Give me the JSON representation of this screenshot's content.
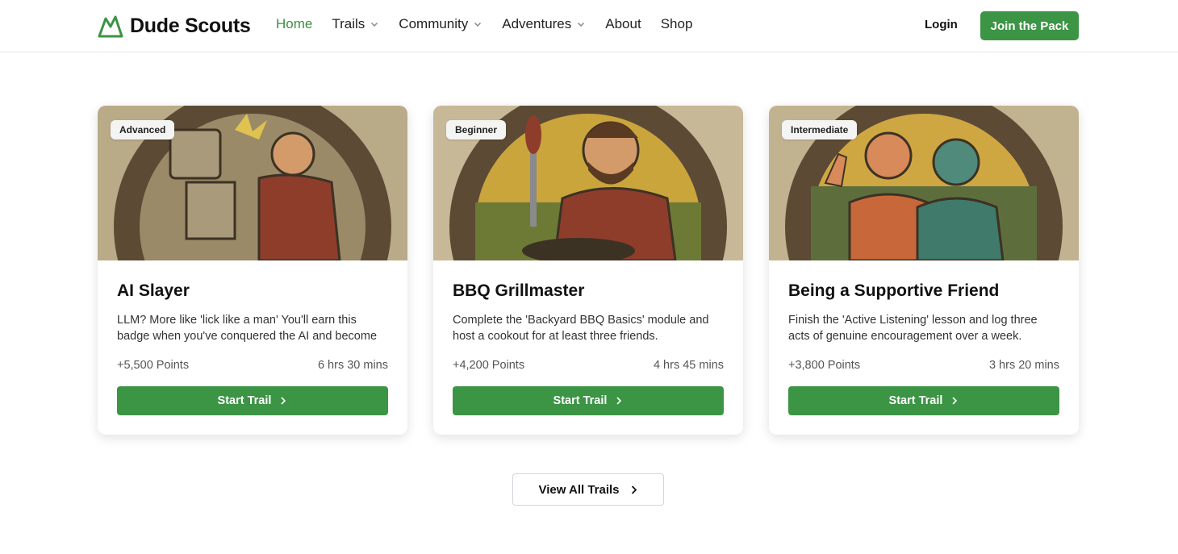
{
  "brand": {
    "name": "Dude Scouts",
    "logo_icon": "mountain-icon",
    "accent": "#3c9445"
  },
  "nav": {
    "items": [
      {
        "label": "Home",
        "active": true,
        "dropdown": false
      },
      {
        "label": "Trails",
        "active": false,
        "dropdown": true
      },
      {
        "label": "Community",
        "active": false,
        "dropdown": true
      },
      {
        "label": "Adventures",
        "active": false,
        "dropdown": true
      },
      {
        "label": "About",
        "active": false,
        "dropdown": false
      },
      {
        "label": "Shop",
        "active": false,
        "dropdown": false
      }
    ]
  },
  "header": {
    "login_label": "Login",
    "join_label": "Join the Pack"
  },
  "cards": [
    {
      "level": "Advanced",
      "title": "AI Slayer",
      "description": "LLM? More like 'lick like a man' You'll earn this badge when you've conquered the AI and become",
      "points": "+5,500 Points",
      "duration": "6 hrs 30 mins",
      "button_label": "Start Trail"
    },
    {
      "level": "Beginner",
      "title": "BBQ Grillmaster",
      "description": "Complete the 'Backyard BBQ Basics' module and host a cookout for at least three friends.",
      "points": "+4,200 Points",
      "duration": "4 hrs 45 mins",
      "button_label": "Start Trail"
    },
    {
      "level": "Intermediate",
      "title": "Being a Supportive Friend",
      "description": "Finish the 'Active Listening' lesson and log three acts of genuine encouragement over a week.",
      "points": "+3,800 Points",
      "duration": "3 hrs 20 mins",
      "button_label": "Start Trail"
    }
  ],
  "view_all_label": "View All Trails"
}
